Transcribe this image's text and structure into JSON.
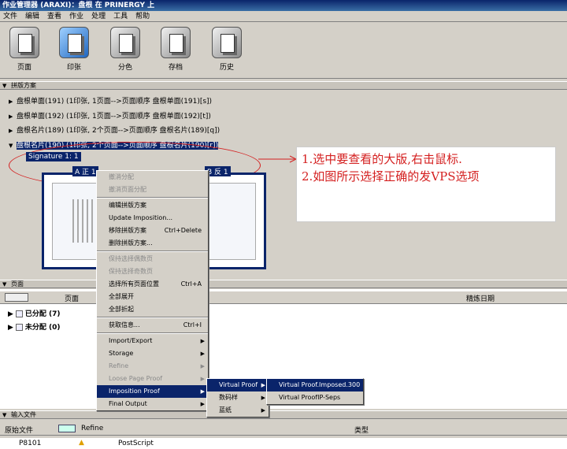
{
  "window": {
    "title": "作业管理器 (ARAXI)：盘根 在 PRINERGY 上"
  },
  "menubar": [
    "文件",
    "编辑",
    "查看",
    "作业",
    "处理",
    "工具",
    "帮助"
  ],
  "toolbar": [
    {
      "label": "页面",
      "icon": "page-icon"
    },
    {
      "label": "印张",
      "icon": "imposition-icon",
      "active": true
    },
    {
      "label": "分色",
      "icon": "separation-icon"
    },
    {
      "label": "存档",
      "icon": "archive-icon"
    },
    {
      "label": "历史",
      "icon": "history-icon"
    }
  ],
  "section1": {
    "title": "拼版方案"
  },
  "plans": [
    {
      "text": "盘根单面(191) (1印张, 1页面-->页面顺序 盘根单面(191)[s])",
      "expanded": false
    },
    {
      "text": "盘根单面(192) (1印张, 1页面-->页面顺序 盘根单面(192)[t])",
      "expanded": false
    },
    {
      "text": "盘根名片(189) (1印张, 2个页面-->页面顺序 盘根名片(189)[q])",
      "expanded": false
    },
    {
      "text": "盘根名片(190) (1印张, 2个页面-->页面顺序 盘根名片(190)[r])",
      "expanded": true,
      "selected": true
    }
  ],
  "signature": {
    "label": "Signature 1: 1",
    "side_a": "A 正 1",
    "side_b": "B 反 1"
  },
  "annotation": {
    "line1": "1.选中要查看的大版,右击鼠标.",
    "line2": "2.如图所示选择正确的发VPS选项"
  },
  "section2": {
    "title": "页面",
    "col_page": "页面",
    "col_date": "精炼日期"
  },
  "page_groups": [
    {
      "label": "已分配 (7)"
    },
    {
      "label": "未分配 (0)"
    }
  ],
  "section3": {
    "title": "输入文件",
    "col_source": "原始文件",
    "col_refine": "Refine",
    "col_type": "类型"
  },
  "input_file": {
    "name": "P8101",
    "type": "PostScript"
  },
  "context_menu": [
    {
      "label": "撤消分配",
      "disabled": true
    },
    {
      "label": "撤消页面分配",
      "disabled": true
    },
    {
      "sep": true
    },
    {
      "label": "编辑拼版方案"
    },
    {
      "label": "Update Imposition..."
    },
    {
      "label": "移除拼版方案",
      "shortcut": "Ctrl+Delete"
    },
    {
      "label": "删除拼版方案..."
    },
    {
      "sep": true
    },
    {
      "label": "保持选择偶数页",
      "disabled": true
    },
    {
      "label": "保持选择奇数页",
      "disabled": true
    },
    {
      "label": "选择所有页面位置",
      "shortcut": "Ctrl+A"
    },
    {
      "label": "全部展开"
    },
    {
      "label": "全部折起"
    },
    {
      "sep": true
    },
    {
      "label": "获取信息...",
      "shortcut": "Ctrl+I"
    },
    {
      "sep": true
    },
    {
      "label": "Import/Export",
      "submenu": true
    },
    {
      "label": "Storage",
      "submenu": true
    },
    {
      "label": "Refine",
      "submenu": true,
      "disabled": true
    },
    {
      "label": "Loose Page Proof",
      "submenu": true,
      "disabled": true
    },
    {
      "label": "Imposition Proof",
      "submenu": true,
      "highlight": true
    },
    {
      "label": "Final Output",
      "submenu": true
    }
  ],
  "submenu1": [
    {
      "label": "Virtual Proof",
      "submenu": true,
      "highlight": true
    },
    {
      "label": "数码样",
      "submenu": true
    },
    {
      "label": "蓝纸",
      "submenu": true
    }
  ],
  "submenu2": [
    {
      "label": "Virtual Proof.Imposed.300",
      "highlight": true
    },
    {
      "label": "Virtual ProofIP-Seps"
    }
  ]
}
